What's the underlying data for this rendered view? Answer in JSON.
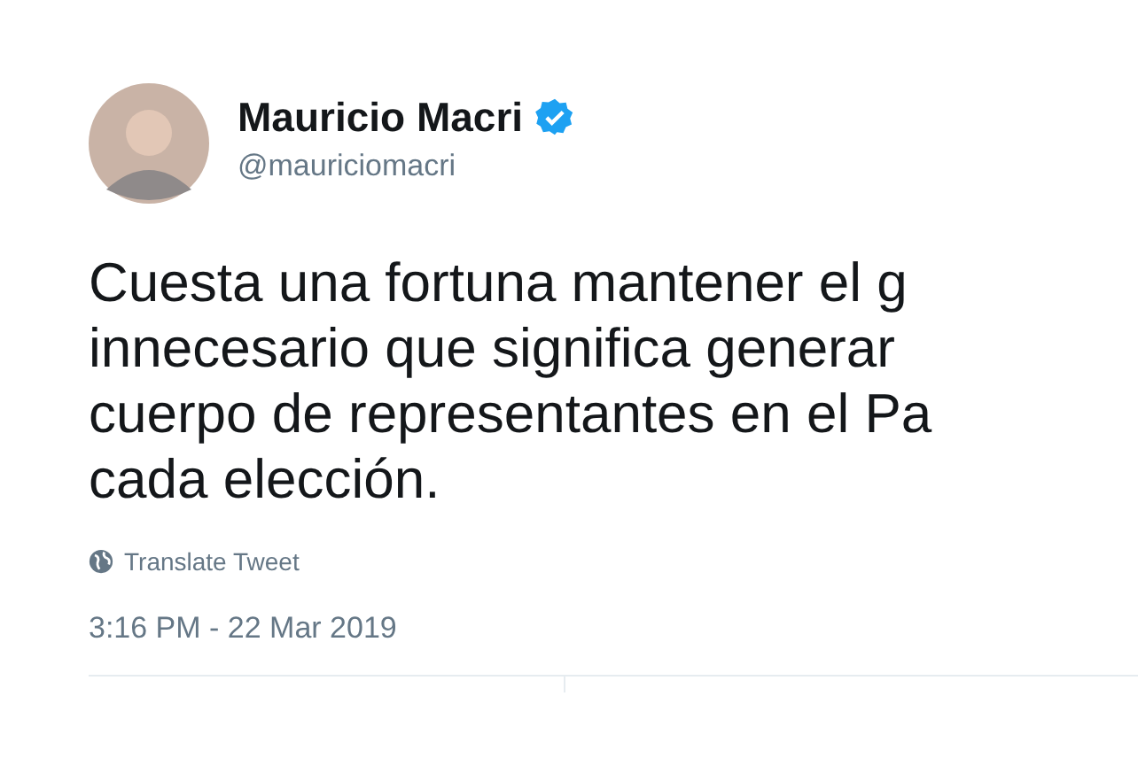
{
  "author": {
    "name": "Mauricio Macri",
    "verified": true,
    "handle": "@mauriciomacri"
  },
  "tweet": {
    "lines": [
      "Cuesta una fortuna mantener el g",
      "innecesario que significa generar",
      "cuerpo de representantes en el Pa",
      "cada elección."
    ]
  },
  "translate": "Translate Tweet",
  "timestamp": "3:16 PM - 22 Mar 2019"
}
